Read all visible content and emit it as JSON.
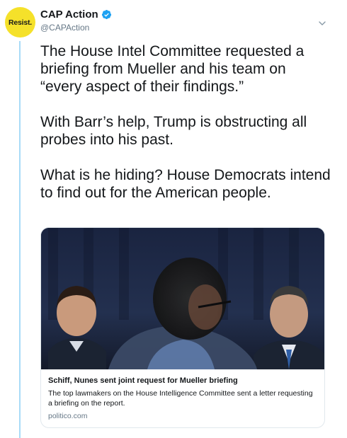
{
  "account": {
    "avatar_text": "Resist.",
    "display_name": "CAP Action",
    "handle": "@CAPAction",
    "verified": true,
    "avatar_color": "#f5e12a"
  },
  "tweet": {
    "paragraphs": [
      "The House Intel Committee requested a briefing from Mueller and his team on “every aspect of their findings.”",
      "With Barr’s help, Trump is obstructing all probes into his past.",
      "What is he hiding? House Democrats intend to find out for the American people."
    ]
  },
  "card": {
    "title": "Schiff, Nunes sent joint request for Mueller briefing",
    "description": "The top lawmakers on the House Intelligence Committee sent a letter requesting a briefing on the report.",
    "domain": "politico.com"
  },
  "icons": {
    "verified": "verified-badge-icon",
    "menu": "chevron-down-icon"
  },
  "colors": {
    "thread_line": "#a9dbf7",
    "verified_blue": "#1da1f2"
  }
}
